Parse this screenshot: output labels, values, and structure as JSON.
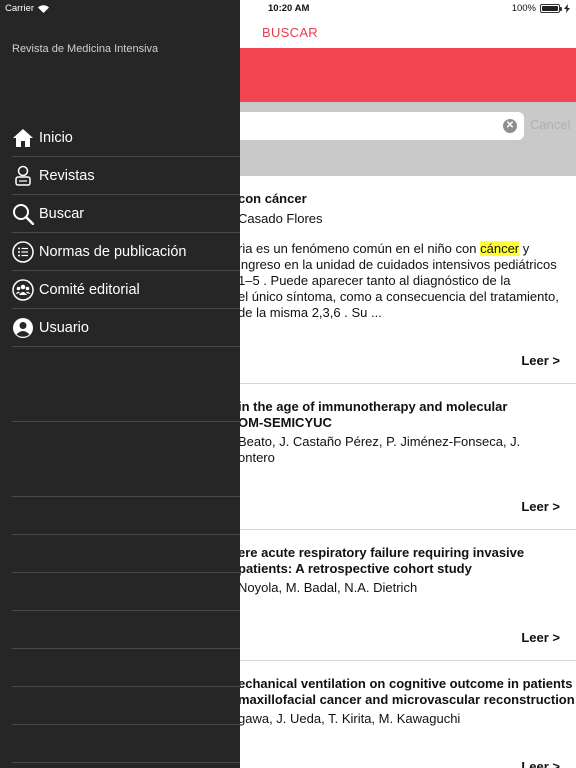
{
  "status_bar": {
    "carrier": "Carrier",
    "time": "10:20 AM",
    "battery": "100%"
  },
  "topbar": {
    "title": "BUSCAR"
  },
  "search": {
    "cancel_label": "Cancel"
  },
  "drawer": {
    "journal_name": "Revista de Medicina Intensiva",
    "items": [
      {
        "label": "Inicio",
        "icon": "home-icon"
      },
      {
        "label": "Revistas",
        "icon": "journal-icon"
      },
      {
        "label": "Buscar",
        "icon": "search-icon"
      },
      {
        "label": "Normas de publicación",
        "icon": "list-icon"
      },
      {
        "label": "Comité editorial",
        "icon": "group-icon"
      },
      {
        "label": "Usuario",
        "icon": "user-icon"
      }
    ]
  },
  "results": [
    {
      "title_lines": [
        "con cáncer"
      ],
      "authors_lines": [
        "Casado Flores"
      ],
      "abstract": {
        "line1_pre": "ria es un fenómeno común en el niño con ",
        "line1_hl": "cáncer",
        "line1_post": " y",
        "lines": [
          "ingreso en la unidad de cuidados intensivos pediátricos",
          " 1–5 . Puede aparecer tanto al diagnóstico de la",
          "el único síntoma, como a consecuencia del tratamiento,",
          "de la misma 2,3,6 . Su ..."
        ]
      },
      "read_label": "Leer >"
    },
    {
      "title_lines": [
        "in the age of immunotherapy and molecular",
        "OM-SEMICYUC"
      ],
      "authors_lines": [
        "Beato, J. Castaño Pérez, P. Jiménez-Fonseca, J.",
        "ontero"
      ],
      "read_label": "Leer >"
    },
    {
      "title_lines": [
        "ere acute respiratory failure requiring invasive",
        "patients: A retrospective cohort study"
      ],
      "authors_lines": [
        "Noyola, M. Badal, N.A. Dietrich"
      ],
      "read_label": "Leer >"
    },
    {
      "title_lines": [
        "echanical ventilation on cognitive outcome in patients",
        "maxillofacial cancer and microvascular reconstruction"
      ],
      "authors_lines": [
        "gawa, J. Ueda, T. Kirita, M. Kawaguchi"
      ],
      "read_label": "Leer >"
    }
  ]
}
